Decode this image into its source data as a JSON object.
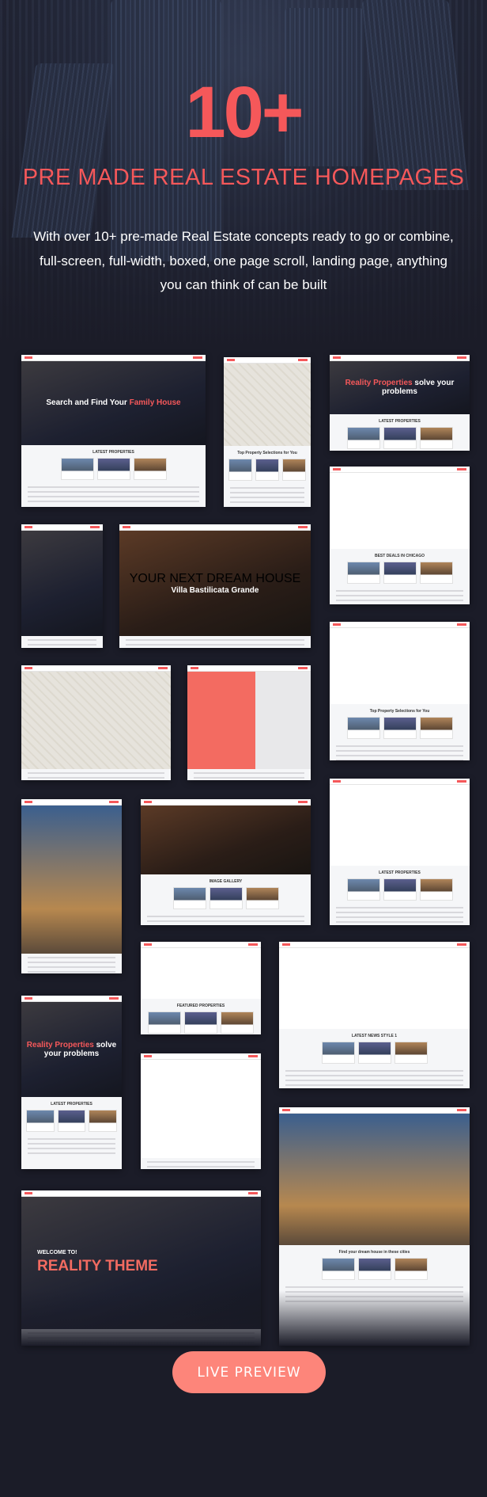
{
  "hero": {
    "count": "10+",
    "subtitle": "PRE MADE REAL ESTATE HOMEPAGES",
    "description": "With over 10+ pre-made Real Estate concepts ready  to go or combine, full-screen, full-width, boxed, one page scroll, landing page, anything you can think of can be built"
  },
  "colors": {
    "accent": "#f5585a",
    "button": "#fd857a",
    "background": "#1b1c28"
  },
  "thumbnails": [
    {
      "style": "dark",
      "headline_pre": "Search and Find Your ",
      "headline_accent": "Family House",
      "section": "LATEST PROPERTIES"
    },
    {
      "style": "map",
      "headline_pre": "",
      "headline_accent": "",
      "section": "Top Property Selections for You"
    },
    {
      "style": "dark",
      "headline_pre": "",
      "headline_accent": "Reality Properties",
      "headline_post": " solve your problems",
      "section": "LATEST PROPERTIES"
    },
    {
      "style": "light",
      "headline_pre": "",
      "headline_accent": "",
      "section": "BEST DEALS IN CHICAGO"
    },
    {
      "style": "dark",
      "headline_pre": "",
      "headline_accent": "",
      "section": ""
    },
    {
      "style": "warm",
      "pre": "YOUR NEXT DREAM HOUSE",
      "headline_pre": "Villa Bastilicata Grande",
      "headline_accent": "",
      "section": ""
    },
    {
      "style": "light",
      "headline_pre": "",
      "headline_accent": "",
      "section": "Top Property Selections for You"
    },
    {
      "style": "map",
      "headline_pre": "",
      "headline_accent": "",
      "section": ""
    },
    {
      "style": "coral",
      "headline_pre": "",
      "headline_accent": "",
      "section": ""
    },
    {
      "style": "city",
      "headline_pre": "",
      "headline_accent": "",
      "section": ""
    },
    {
      "style": "warm",
      "headline_pre": "",
      "headline_accent": "",
      "section": "IMAGE GALLERY"
    },
    {
      "style": "light",
      "headline_pre": "",
      "headline_accent": "",
      "section": "LATEST PROPERTIES"
    },
    {
      "style": "light",
      "headline_pre": "",
      "headline_accent": "",
      "section": "FEATURED PROPERTIES"
    },
    {
      "style": "light",
      "headline_pre": "",
      "headline_accent": "",
      "section": "LATEST NEWS STYLE 1"
    },
    {
      "style": "dark",
      "headline_pre": "",
      "headline_accent": "Reality Properties",
      "headline_post": " solve your problems",
      "section": "LATEST PROPERTIES"
    },
    {
      "style": "light",
      "headline_pre": "",
      "headline_accent": "",
      "section": ""
    },
    {
      "style": "city",
      "headline_pre": "",
      "headline_accent": "",
      "section": "Find your dream house in these cities"
    },
    {
      "style": "dark",
      "pre": "WELCOME TO!",
      "headline_pre": "REALITY THEME",
      "headline_accent": "",
      "section": ""
    }
  ],
  "cta": {
    "label": "LIVE PREVIEW"
  }
}
